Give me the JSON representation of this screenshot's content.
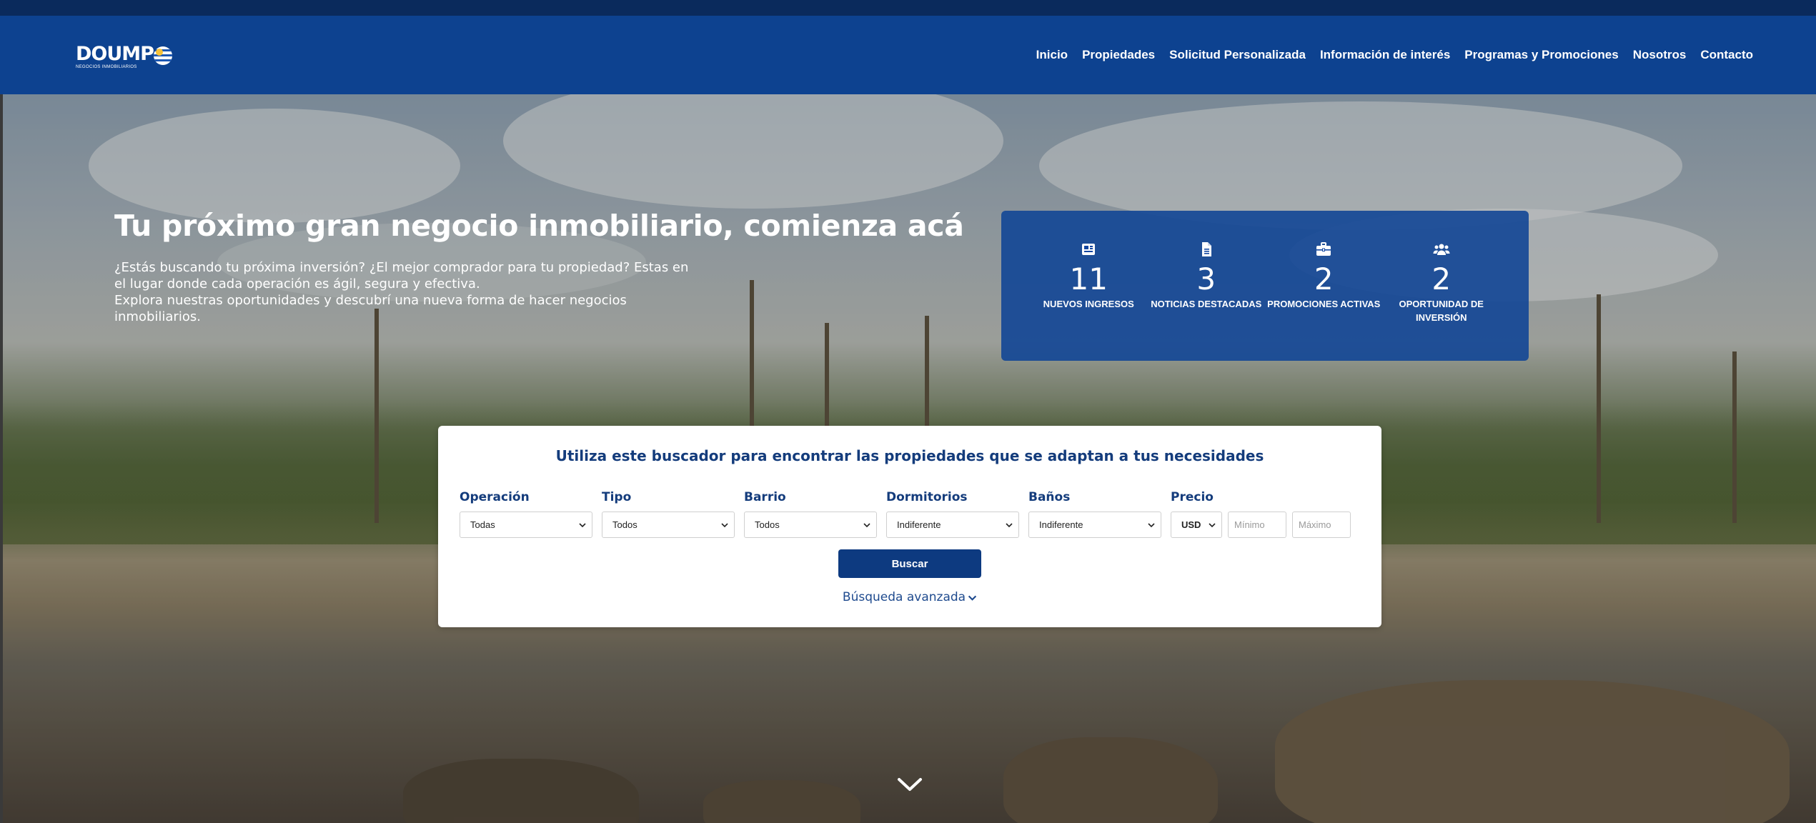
{
  "brand": {
    "name": "DOUMP",
    "tagline": "NEGOCIOS INMOBILIARIOS"
  },
  "nav": {
    "items": [
      "Inicio",
      "Propiedades",
      "Solicitud Personalizada",
      "Información de interés",
      "Programas y Promociones",
      "Nosotros",
      "Contacto"
    ]
  },
  "hero": {
    "title": "Tu próximo gran negocio inmobiliario, comienza acá",
    "intro_line1": "¿Estás buscando tu próxima inversión? ¿El mejor comprador para tu propiedad? Estas en el lugar donde cada operación es ágil, segura y efectiva.",
    "intro_line2": "Explora nuestras oportunidades y descubrí una nueva forma de hacer negocios inmobiliarios."
  },
  "stats": [
    {
      "icon": "newspaper-icon",
      "value": "11",
      "label": "NUEVOS INGRESOS"
    },
    {
      "icon": "document-icon",
      "value": "3",
      "label": "NOTICIAS DESTACADAS"
    },
    {
      "icon": "briefcase-icon",
      "value": "2",
      "label": "PROMOCIONES ACTIVAS"
    },
    {
      "icon": "users-icon",
      "value": "2",
      "label": "OPORTUNIDAD DE INVERSIÓN"
    }
  ],
  "search": {
    "title": "Utiliza este buscador para encontrar las propiedades que se adaptan a tus necesidades",
    "fields": {
      "operacion": {
        "label": "Operación",
        "value": "Todas"
      },
      "tipo": {
        "label": "Tipo",
        "value": "Todos"
      },
      "barrio": {
        "label": "Barrio",
        "value": "Todos"
      },
      "dormitorios": {
        "label": "Dormitorios",
        "value": "Indiferente"
      },
      "banos": {
        "label": "Baños",
        "value": "Indiferente"
      },
      "precio": {
        "label": "Precio",
        "currency": "USD",
        "min_placeholder": "Mínimo",
        "max_placeholder": "Máximo"
      }
    },
    "button": "Buscar",
    "advanced": "Búsqueda avanzada"
  },
  "colors": {
    "nav_bg": "#0d4290",
    "top_bar": "#0a2a5c",
    "stats_bg": "#1246a0",
    "button_bg": "#0d3a80",
    "accent_text": "#143c7c"
  }
}
